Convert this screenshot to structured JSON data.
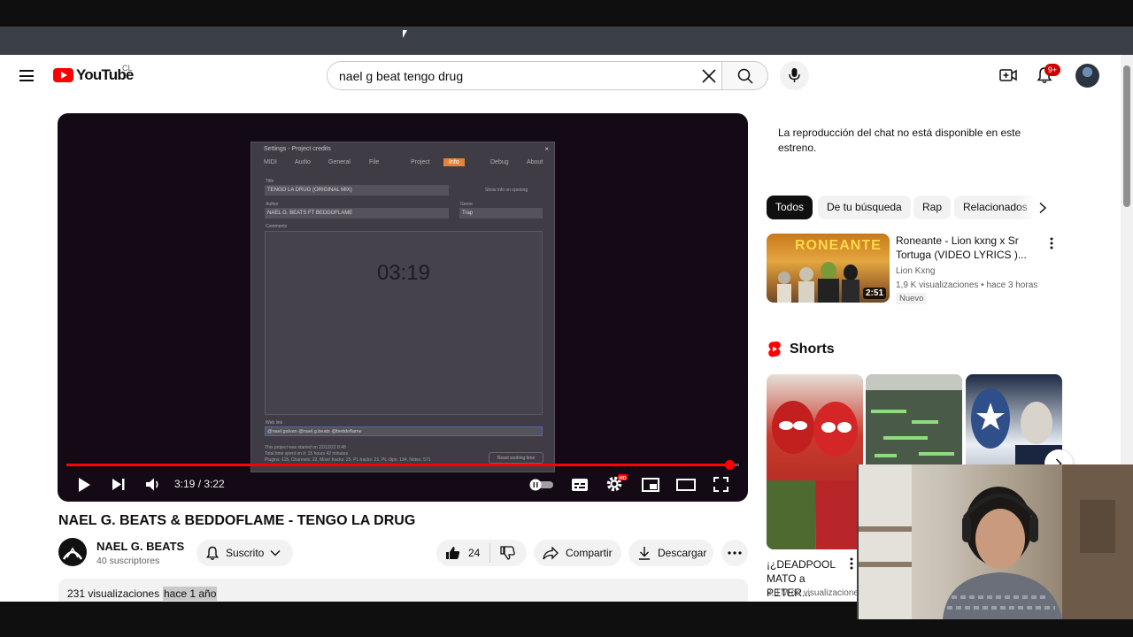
{
  "header": {
    "logo_text": "YouTube",
    "country_code": "CL",
    "search_value": "nael g beat tengo drug",
    "notification_count": "9+"
  },
  "player": {
    "current_time": "3:19",
    "duration": "3:22",
    "time_display": "3:19 / 3:22",
    "progress_fraction": 0.986,
    "screen": {
      "dialog_title": "Settings - Project credits",
      "tabs": [
        "MIDI",
        "Audio",
        "General",
        "File",
        "Project",
        "Info",
        "Debug",
        "About"
      ],
      "active_tab": "Info",
      "title_label": "Title",
      "title_value": "TENGO LA DRUG (ORIGINAL MIX)",
      "show_info_label": "Show info on opening",
      "author_label": "Author",
      "author_value": "NAEL G. BEATS FT BEDDOFLAME",
      "genre_label": "Genre",
      "genre_value": "Trap",
      "comments_label": "Comments",
      "big_time": "03:19",
      "web_link_label": "Web link",
      "web_link_value": "@nael.galvan @nael.g.beats @beddoflame",
      "info_line1": "This project was started on 22/12/22 8:48",
      "info_line2": "Total time spent on it: 15 hours 42 minutes",
      "info_line3": "Plugins: 115, Channels: 22, Mixer tracks: 25, PL tracks: 21, PL clips: 134, Notes: 571",
      "reset_button": "Reset working time"
    }
  },
  "video": {
    "title": "NAEL G. BEATS & BEDDOFLAME - TENGO LA DRUG",
    "channel_name": "NAEL G. BEATS",
    "subscribers": "40 suscriptores",
    "subscribe_label": "Suscrito",
    "likes": "24",
    "share_label": "Compartir",
    "download_label": "Descargar",
    "views": "231 visualizaciones",
    "date": "hace 1 año"
  },
  "sidebar": {
    "chat_message": "La reproducción del chat no está disponible en este estreno.",
    "chips": [
      "Todos",
      "De tu búsqueda",
      "Rap",
      "Relacionados"
    ],
    "active_chip": "Todos",
    "recommendation": {
      "thumb_text": "RONEANTE",
      "duration": "2:51",
      "title": "Roneante - Lion kxng x Sr Tortuga (VIDEO LYRICS )...",
      "channel": "Lion Kxng",
      "meta": "1,9 K visualizaciones  • hace 3 horas",
      "badge": "Nuevo"
    },
    "shorts_title": "Shorts",
    "short": {
      "title": "¡¿DEADPOOL MATO a PETER...",
      "views": "3,8 M de visualizaciones"
    }
  },
  "colors": {
    "brand_red": "#ff0000",
    "progress_red": "#ff0000",
    "fl_accent": "#e0853a"
  }
}
